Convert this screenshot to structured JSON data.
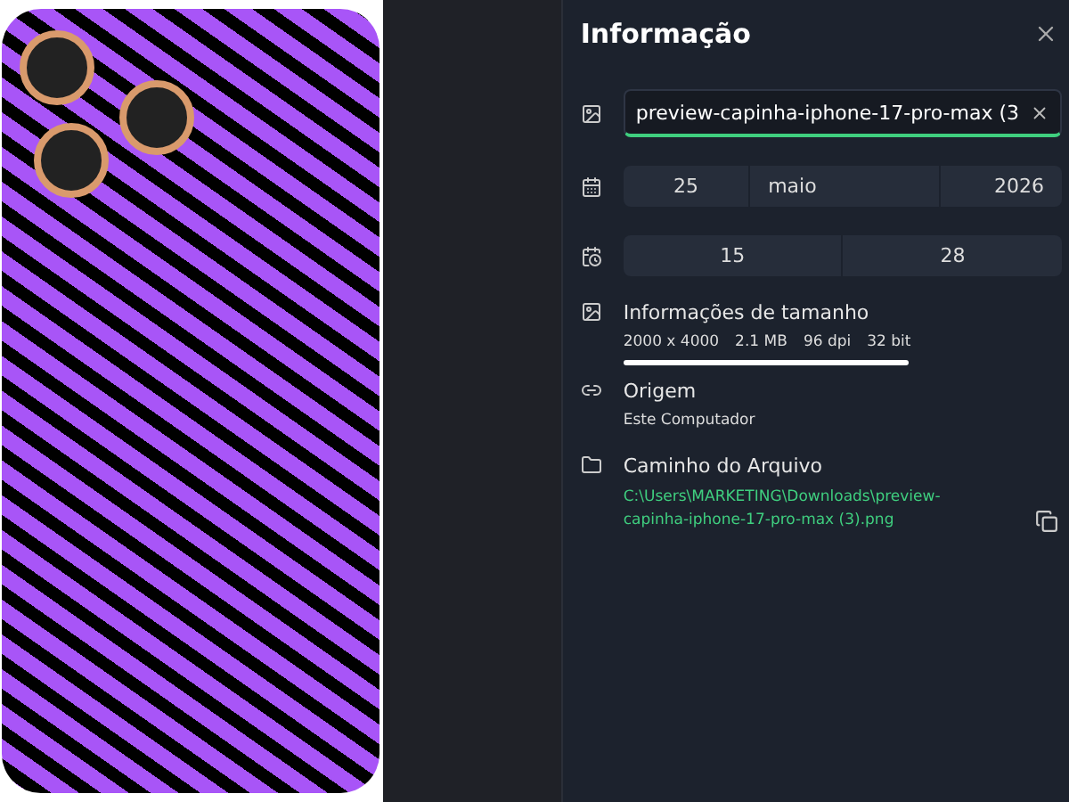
{
  "panel": {
    "title": "Informação"
  },
  "filename": {
    "value": "preview-capinha-iphone-17-pro-max (3"
  },
  "date": {
    "day": "25",
    "month": "maio",
    "year": "2026"
  },
  "time": {
    "hour": "15",
    "minute": "28"
  },
  "size_info": {
    "label": "Informações de tamanho",
    "values": [
      "2000 x 4000",
      "2.1 MB",
      "96 dpi",
      "32 bit"
    ]
  },
  "origin": {
    "label": "Origem",
    "value": "Este Computador"
  },
  "file_path": {
    "label": "Caminho do Arquivo",
    "value": "C:\\Users\\MARKETING\\Downloads\\preview-capinha-iphone-17-pro-max (3).png"
  }
}
